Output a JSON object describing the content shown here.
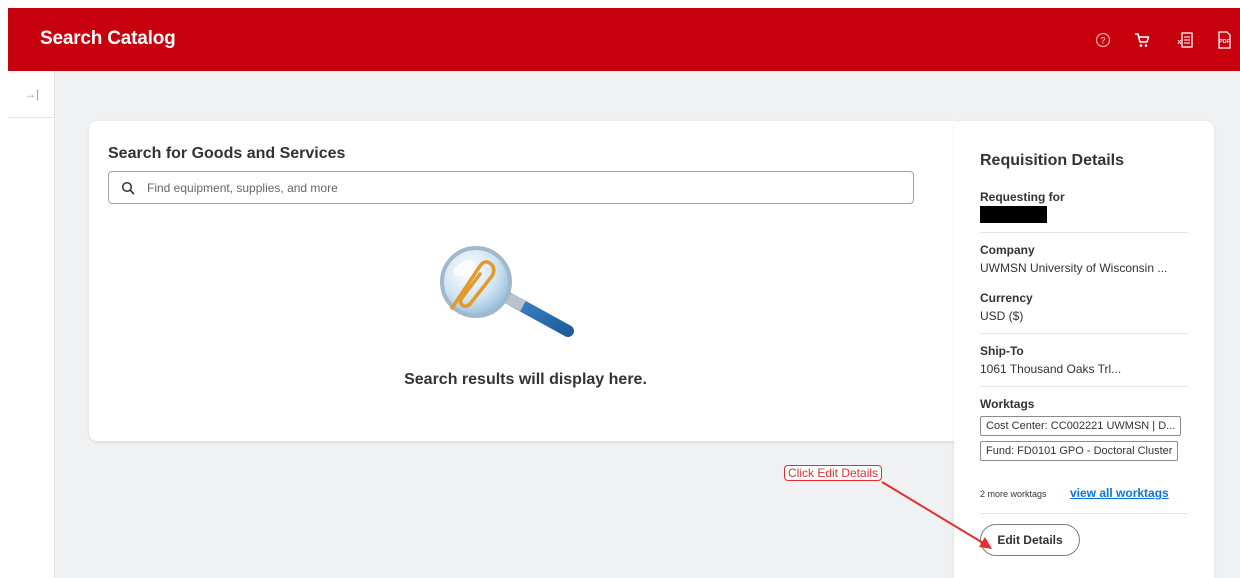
{
  "header": {
    "title": "Search Catalog",
    "icons": [
      "help-icon",
      "cart-icon",
      "excel-export-icon",
      "pdf-export-icon"
    ]
  },
  "sidebar": {
    "expand_glyph": "→|"
  },
  "search": {
    "title": "Search for Goods and Services",
    "placeholder": "Find equipment, supplies, and more",
    "empty_message": "Search results will display here."
  },
  "requisition": {
    "title": "Requisition Details",
    "requesting_for_label": "Requesting for",
    "company_label": "Company",
    "company_value": "UWMSN University of Wisconsin ...",
    "currency_label": "Currency",
    "currency_value": "USD ($)",
    "ship_to_label": "Ship-To",
    "ship_to_value": "1061 Thousand Oaks Trl...",
    "worktags_label": "Worktags",
    "worktags": [
      "Cost Center: CC002221 UWMSN | D...",
      "Fund: FD0101 GPO - Doctoral Cluster"
    ],
    "more_worktags": "2 more worktags",
    "view_all_link": "view all worktags",
    "edit_button": "Edit Details"
  },
  "annotation": {
    "text": "Click Edit Details"
  },
  "colors": {
    "header_bg": "#c8000d",
    "link": "#0875e1",
    "annotation": "#e03030",
    "page_bg": "#f0f1f2"
  }
}
